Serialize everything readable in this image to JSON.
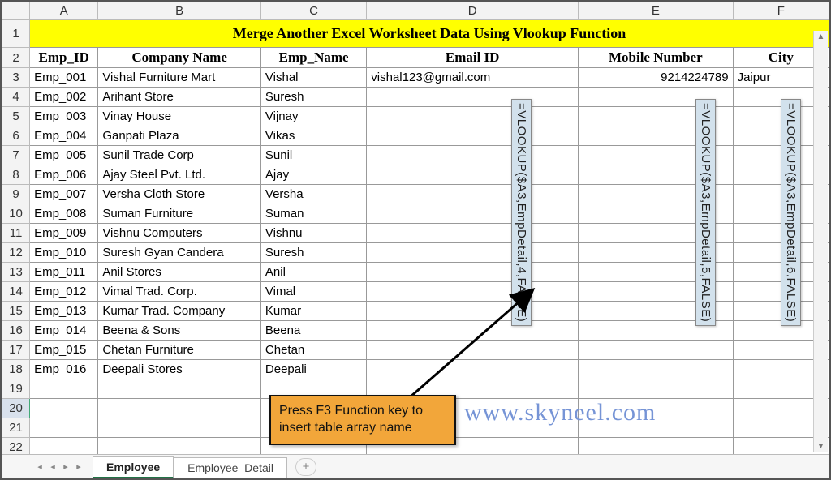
{
  "title": "Merge Another Excel Worksheet Data Using Vlookup Function",
  "columns": [
    "A",
    "B",
    "C",
    "D",
    "E",
    "F"
  ],
  "headers": {
    "A": "Emp_ID",
    "B": "Company Name",
    "C": "Emp_Name",
    "D": "Email ID",
    "E": "Mobile Number",
    "F": "City"
  },
  "rows": [
    {
      "n": 3,
      "A": "Emp_001",
      "B": "Vishal Furniture Mart",
      "C": "Vishal",
      "D": "vishal123@gmail.com",
      "E": "9214224789",
      "F": "Jaipur"
    },
    {
      "n": 4,
      "A": "Emp_002",
      "B": "Arihant Store",
      "C": "Suresh",
      "D": "",
      "E": "",
      "F": ""
    },
    {
      "n": 5,
      "A": "Emp_003",
      "B": "Vinay House",
      "C": "Vijnay",
      "D": "",
      "E": "",
      "F": ""
    },
    {
      "n": 6,
      "A": "Emp_004",
      "B": "Ganpati Plaza",
      "C": "Vikas",
      "D": "",
      "E": "",
      "F": ""
    },
    {
      "n": 7,
      "A": "Emp_005",
      "B": "Sunil Trade Corp",
      "C": "Sunil",
      "D": "",
      "E": "",
      "F": ""
    },
    {
      "n": 8,
      "A": "Emp_006",
      "B": "Ajay Steel Pvt. Ltd.",
      "C": "Ajay",
      "D": "",
      "E": "",
      "F": ""
    },
    {
      "n": 9,
      "A": "Emp_007",
      "B": "Versha Cloth Store",
      "C": "Versha",
      "D": "",
      "E": "",
      "F": ""
    },
    {
      "n": 10,
      "A": "Emp_008",
      "B": "Suman Furniture",
      "C": "Suman",
      "D": "",
      "E": "",
      "F": ""
    },
    {
      "n": 11,
      "A": "Emp_009",
      "B": "Vishnu Computers",
      "C": "Vishnu",
      "D": "",
      "E": "",
      "F": ""
    },
    {
      "n": 12,
      "A": "Emp_010",
      "B": "Suresh Gyan Candera",
      "C": "Suresh",
      "D": "",
      "E": "",
      "F": ""
    },
    {
      "n": 13,
      "A": "Emp_011",
      "B": "Anil Stores",
      "C": "Anil",
      "D": "",
      "E": "",
      "F": ""
    },
    {
      "n": 14,
      "A": "Emp_012",
      "B": "Vimal Trad. Corp.",
      "C": "Vimal",
      "D": "",
      "E": "",
      "F": ""
    },
    {
      "n": 15,
      "A": "Emp_013",
      "B": "Kumar Trad. Company",
      "C": "Kumar",
      "D": "",
      "E": "",
      "F": ""
    },
    {
      "n": 16,
      "A": "Emp_014",
      "B": "Beena & Sons",
      "C": "Beena",
      "D": "",
      "E": "",
      "F": ""
    },
    {
      "n": 17,
      "A": "Emp_015",
      "B": "Chetan Furniture",
      "C": "Chetan",
      "D": "",
      "E": "",
      "F": ""
    },
    {
      "n": 18,
      "A": "Emp_016",
      "B": "Deepali Stores",
      "C": "Deepali",
      "D": "",
      "E": "",
      "F": ""
    }
  ],
  "empty_rows": [
    19,
    20,
    21,
    22
  ],
  "selected_row": 20,
  "formulas": {
    "D": "=VLOOKUP($A3,EmpDetail,4,FALSE)",
    "E": "=VLOOKUP($A3,EmpDetail,5,FALSE)",
    "F": "=VLOOKUP($A3,EmpDetail,6,FALSE)"
  },
  "callout": "Press F3 Function key to insert table array name",
  "watermark": "www.skyneel.com",
  "tabs": {
    "active": "Employee",
    "other": "Employee_Detail",
    "add_icon": "+"
  },
  "nav_icons": {
    "first": "◂",
    "prev": "◂",
    "next": "▸",
    "last": "▸"
  },
  "scroll_icons": {
    "up": "▲",
    "down": "▼",
    "left": "◀",
    "right": "▶"
  }
}
